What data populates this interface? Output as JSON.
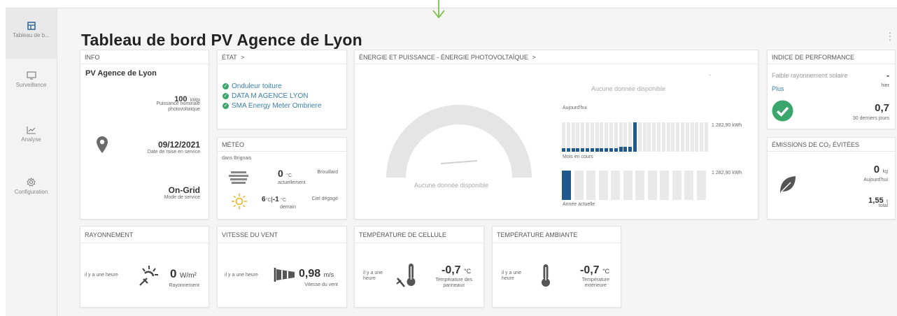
{
  "sidebar": {
    "items": [
      {
        "label": "Tableau de b...",
        "icon": "dashboard-icon",
        "active": true
      },
      {
        "label": "Surveillance",
        "icon": "monitor-icon"
      },
      {
        "label": "Analyse",
        "icon": "chart-icon"
      },
      {
        "label": "Configuration",
        "icon": "gear-icon"
      }
    ]
  },
  "page": {
    "title": "Tableau de bord PV Agence de Lyon"
  },
  "info": {
    "header": "INFO",
    "plant_name": "PV Agence de Lyon",
    "power_value": "100",
    "power_unit": "kWp",
    "power_label_1": "Puissance nominale",
    "power_label_2": "photovoltaïque",
    "date_value": "09/12/2021",
    "date_label": "Date de mise en service",
    "mode_value": "On-Grid",
    "mode_label": "Mode de service"
  },
  "etat": {
    "header": "ÉTAT",
    "devices": [
      "Onduleur toiture",
      "DATA M AGENCE LYON",
      "SMA Energy Meter Ombriere"
    ],
    "status_color": "#3aa66b"
  },
  "meteo": {
    "header": "MÉTÉO",
    "location": "dans Brignais",
    "now_value": "0",
    "now_unit": "°C",
    "now_label": "actuellement",
    "now_desc": "Brouillard",
    "tomorrow_value": "6",
    "tomorrow_unit1": "°C",
    "tomorrow_sep": "|",
    "tomorrow_min": "-1",
    "tomorrow_unit2": "°C",
    "tomorrow_label": "demain",
    "tomorrow_desc": "Ciel dégagé"
  },
  "energie": {
    "header": "ÉNERGIE ET PUISSANCE - ÉNERGIE PHOTOVOLTAÏQUE",
    "no_data_gauge": "Aucune donnée disponible",
    "no_data_top": "Aucune donnée disponible",
    "dash": "-",
    "today_label": "Aujourd'hui",
    "month_label": "Mois en cours",
    "year_label": "Année actuelle",
    "month_max": "1 282,90 kWh",
    "year_max": "1 282,90 kWh",
    "accent": "#1e5a8e"
  },
  "chart_data": [
    {
      "type": "bar",
      "title": "Mois en cours",
      "values": [
        3,
        3,
        3,
        3,
        3,
        3,
        3,
        3,
        3,
        3,
        3,
        3,
        4,
        4,
        4,
        25,
        0,
        0,
        0,
        0,
        0,
        0,
        0,
        0,
        0,
        0,
        0,
        0,
        0,
        0,
        0
      ],
      "ylabel": "1 282,90 kWh"
    },
    {
      "type": "bar",
      "title": "Année actuelle",
      "values": [
        100,
        0,
        0,
        0,
        0,
        0,
        0,
        0,
        0,
        0,
        0,
        0
      ],
      "ylabel": "1 282,90 kWh"
    }
  ],
  "performance": {
    "header": "INDICE DE PERFORMANCE",
    "low_irradiation": "Faible rayonnement solaire",
    "more_link": "Plus",
    "yesterday_value": "-",
    "yesterday_label": "hier",
    "value": "0,7",
    "value_label": "30 derniers jours"
  },
  "co2": {
    "header": "ÉMISSIONS DE CO₂ ÉVITÉES",
    "today_value": "0",
    "today_unit": "kg",
    "today_label": "Aujourd'hui",
    "total_value": "1,55",
    "total_unit": "t",
    "total_label": "total"
  },
  "rayonnement": {
    "header": "RAYONNEMENT",
    "time": "il y a une heure",
    "value": "0",
    "unit": "W/m²",
    "label": "Rayonnement"
  },
  "vent": {
    "header": "VITESSE DU VENT",
    "time": "il y a une heure",
    "value": "0,98",
    "unit": "m/s",
    "label": "Vitesse du vent"
  },
  "temp_cellule": {
    "header": "TEMPÉRATURE DE CELLULE",
    "time1": "il y a une",
    "time2": "heure",
    "value": "-0,7",
    "unit": "°C",
    "label1": "Température des",
    "label2": "panneaux"
  },
  "temp_ambiante": {
    "header": "TEMPÉRATURE AMBIANTE",
    "time1": "il y a une",
    "time2": "heure",
    "value": "-0,7",
    "unit": "°C",
    "label1": "Température",
    "label2": "extérieure"
  }
}
